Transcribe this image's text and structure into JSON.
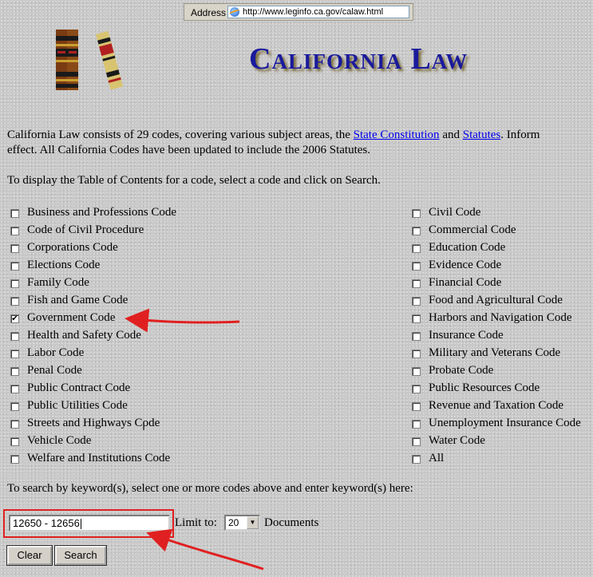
{
  "browser": {
    "address_label": "Address",
    "url": "http://www.leginfo.ca.gov/calaw.html"
  },
  "header": {
    "title": "California Law"
  },
  "intro": {
    "line1_prefix": "California Law consists of 29 codes, covering various subject areas, the ",
    "link_constitution": "State Constitution",
    "and_text": " and ",
    "link_statutes": "Statutes",
    "line1_suffix": ". Inform",
    "line2": "effect. All California Codes have been updated to include the 2006 Statutes."
  },
  "instructions": "To display the Table of Contents for a code, select a code and click on Search.",
  "codes": {
    "left": [
      {
        "label": "Business and Professions Code",
        "checked": false
      },
      {
        "label": "Code of Civil Procedure",
        "checked": false
      },
      {
        "label": "Corporations Code",
        "checked": false
      },
      {
        "label": "Elections Code",
        "checked": false
      },
      {
        "label": "Family Code",
        "checked": false
      },
      {
        "label": "Fish and Game Code",
        "checked": false
      },
      {
        "label": "Government Code",
        "checked": true
      },
      {
        "label": "Health and Safety Code",
        "checked": false
      },
      {
        "label": "Labor Code",
        "checked": false
      },
      {
        "label": "Penal Code",
        "checked": false
      },
      {
        "label": "Public Contract Code",
        "checked": false
      },
      {
        "label": "Public Utilities Code",
        "checked": false
      },
      {
        "label": "Streets and Highways Code",
        "checked": false
      },
      {
        "label": "Vehicle Code",
        "checked": false
      },
      {
        "label": "Welfare and Institutions Code",
        "checked": false
      }
    ],
    "right": [
      {
        "label": "Civil Code",
        "checked": false
      },
      {
        "label": "Commercial Code",
        "checked": false
      },
      {
        "label": "Education Code",
        "checked": false
      },
      {
        "label": "Evidence Code",
        "checked": false
      },
      {
        "label": "Financial Code",
        "checked": false
      },
      {
        "label": "Food and Agricultural Code",
        "checked": false
      },
      {
        "label": "Harbors and Navigation Code",
        "checked": false
      },
      {
        "label": "Insurance Code",
        "checked": false
      },
      {
        "label": "Military and Veterans Code",
        "checked": false
      },
      {
        "label": "Probate Code",
        "checked": false
      },
      {
        "label": "Public Resources Code",
        "checked": false
      },
      {
        "label": "Revenue and Taxation Code",
        "checked": false
      },
      {
        "label": "Unemployment Insurance Code",
        "checked": false
      },
      {
        "label": "Water Code",
        "checked": false
      },
      {
        "label": "All",
        "checked": false
      }
    ]
  },
  "keyword": {
    "instructions": "To search by keyword(s), select one or more codes above and enter keyword(s) here:",
    "value": "12650 - 12656",
    "limit_label": "Limit to:",
    "limit_value": "20",
    "documents_label": "Documents"
  },
  "buttons": {
    "clear": "Clear",
    "search": "Search"
  },
  "colors": {
    "title": "#1a1a9c",
    "link": "#0000ee",
    "annotation": "#e02020"
  }
}
